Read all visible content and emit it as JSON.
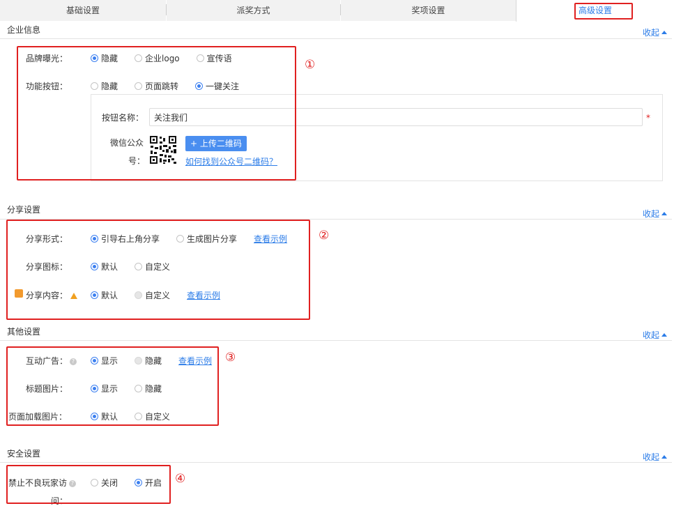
{
  "tabs": [
    {
      "label": "基础设置"
    },
    {
      "label": "派奖方式"
    },
    {
      "label": "奖项设置"
    },
    {
      "label": "高级设置"
    }
  ],
  "collapse_label": "收起",
  "sections": {
    "enterprise": {
      "title": "企业信息",
      "brand_exposure": {
        "label": "品牌曝光：",
        "options": [
          "隐藏",
          "企业logo",
          "宣传语"
        ],
        "selected": 0
      },
      "function_button": {
        "label": "功能按钮：",
        "options": [
          "隐藏",
          "页面跳转",
          "一键关注"
        ],
        "selected": 2
      },
      "button_name": {
        "label": "按钮名称：",
        "value": "关注我们",
        "required_mark": "*"
      },
      "wechat_account": {
        "label_line1": "微信公众",
        "label_line2": "号：",
        "upload_label": "上传二维码",
        "upload_prefix": "+",
        "help_link": "如何找到公众号二维码？"
      }
    },
    "share": {
      "title": "分享设置",
      "share_form": {
        "label": "分享形式：",
        "options": [
          "引导右上角分享",
          "生成图片分享"
        ],
        "selected": 0,
        "link": "查看示例"
      },
      "share_icon": {
        "label": "分享图标：",
        "options": [
          "默认",
          "自定义"
        ],
        "selected": 0
      },
      "share_content": {
        "label": "分享内容：",
        "options": [
          "默认",
          "自定义"
        ],
        "selected": 0,
        "link": "查看示例"
      }
    },
    "other": {
      "title": "其他设置",
      "interactive_ad": {
        "label": "互动广告：",
        "options": [
          "显示",
          "隐藏"
        ],
        "selected": 0,
        "link": "查看示例"
      },
      "title_image": {
        "label": "标题图片：",
        "options": [
          "显示",
          "隐藏"
        ],
        "selected": 0
      },
      "loading_image": {
        "label": "页面加载图片：",
        "options": [
          "默认",
          "自定义"
        ],
        "selected": 0
      }
    },
    "security": {
      "title": "安全设置",
      "block_bad_players": {
        "label_line1": "禁止不良玩家访",
        "label_line2": "问：",
        "options": [
          "关闭",
          "开启"
        ],
        "selected": 1
      }
    }
  },
  "annotations": [
    "①",
    "②",
    "③",
    "④"
  ],
  "colors": {
    "accent": "#2b7ce8",
    "highlight": "#e02020",
    "radio_on": "#3b7ff0",
    "warning": "#f0a020"
  }
}
